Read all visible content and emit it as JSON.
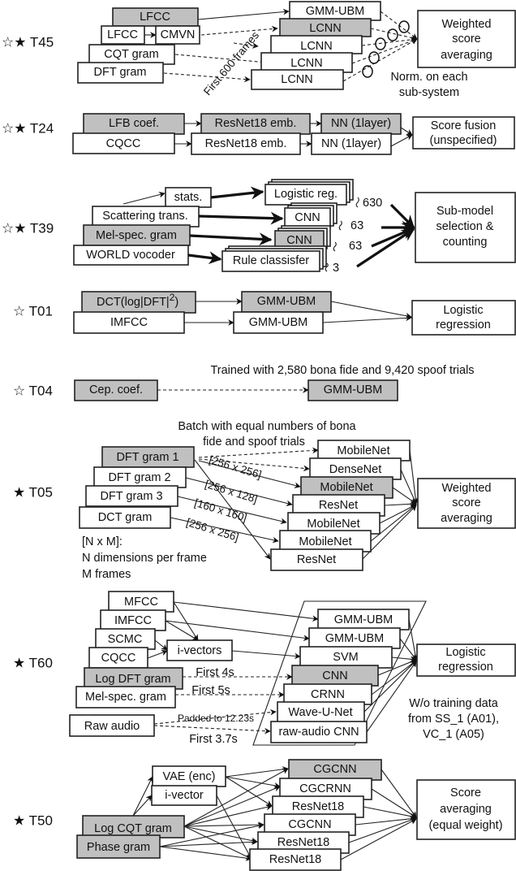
{
  "systems": [
    {
      "id": "T45",
      "label": "☆★ T45",
      "inputs": [
        "LFCC",
        "LFCC",
        "CMVN",
        "CQT gram",
        "DFT gram"
      ],
      "models": [
        "GMM-UBM",
        "LCNN",
        "LCNN",
        "LCNN",
        "LCNN"
      ],
      "annotation": "First 600 frames",
      "fusion": [
        "Weighted",
        "score",
        "averaging"
      ],
      "note": [
        "Norm. on each",
        "sub-system"
      ]
    },
    {
      "id": "T24",
      "label": "☆★ T24",
      "inputs": [
        "LFB coef.",
        "CQCC"
      ],
      "embeddings": [
        "ResNet18 emb.",
        "ResNet18 emb."
      ],
      "models": [
        "NN (1layer)",
        "NN (1layer)"
      ],
      "fusion": [
        "Score fusion",
        "(unspecified)"
      ]
    },
    {
      "id": "T39",
      "label": "☆★ T39",
      "inputs": [
        "stats.",
        "Scattering trans.",
        "Mel-spec. gram",
        "WORLD vocoder"
      ],
      "models": [
        "Logistic reg.",
        "CNN",
        "CNN",
        "Rule classisfer"
      ],
      "counts": [
        "630",
        "63",
        "63",
        "3"
      ],
      "fusion": [
        "Sub-model",
        "selection &",
        "counting"
      ]
    },
    {
      "id": "T01",
      "label": "☆ T01",
      "inputs": [
        "DCT(log|DFT|",
        "IMFCC"
      ],
      "superscript": "2",
      "input0_suffix": ")",
      "models": [
        "GMM-UBM",
        "GMM-UBM"
      ],
      "fusion": [
        "Logistic",
        "regression"
      ]
    },
    {
      "id": "T04",
      "label": "☆ T04",
      "inputs": [
        "Cep. coef."
      ],
      "models": [
        "GMM-UBM"
      ],
      "note": "Trained with 2,580 bona fide and 9,420 spoof trials"
    },
    {
      "id": "T05",
      "label": "★ T05",
      "inputs": [
        "DFT gram 1",
        "DFT gram 2",
        "DFT gram 3",
        "DCT gram"
      ],
      "dims": [
        "[256 x 256]",
        "[256 x 128]",
        "[160 x 160]",
        "[256 x 256]"
      ],
      "models": [
        "MobileNet",
        "DenseNet",
        "MobileNet",
        "ResNet",
        "MobileNet",
        "MobileNet",
        "ResNet"
      ],
      "fusion": [
        "Weighted",
        "score",
        "averaging"
      ],
      "note_top": [
        "Batch with equal numbers of bona",
        "fide and spoof trials"
      ],
      "legend": [
        "[N x M]:",
        "N dimensions per frame",
        "M frames"
      ]
    },
    {
      "id": "T60",
      "label": "★ T60",
      "inputs": [
        "MFCC",
        "IMFCC",
        "SCMC",
        "CQCC",
        "Log DFT gram",
        "Mel-spec. gram",
        "Raw audio"
      ],
      "intermediate": "i-vectors",
      "annotations": [
        "First 4s",
        "First 5s",
        "Padded to 12.23s",
        "First 3.7s"
      ],
      "models": [
        "GMM-UBM",
        "GMM-UBM",
        "SVM",
        "CNN",
        "CRNN",
        "Wave-U-Net",
        "raw-audio CNN"
      ],
      "fusion": [
        "Logistic",
        "regression"
      ],
      "note": [
        "W/o training data",
        "from SS_1 (A01),",
        "VC_1 (A05)"
      ]
    },
    {
      "id": "T50",
      "label": "★ T50",
      "inputs": [
        "Log CQT gram",
        "Phase gram"
      ],
      "intermediate": [
        "VAE (enc)",
        "i-vector"
      ],
      "models": [
        "CGCNN",
        "CGCRNN",
        "ResNet18",
        "CGCNN",
        "ResNet18",
        "ResNet18"
      ],
      "fusion": [
        "Score",
        "averaging",
        "(equal weight)"
      ]
    }
  ]
}
